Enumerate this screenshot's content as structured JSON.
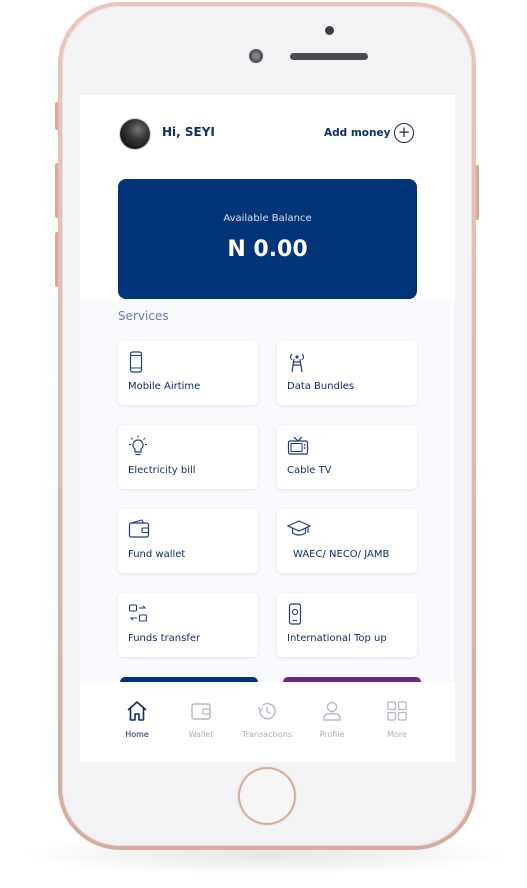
{
  "header": {
    "greeting": "Hi, SEYI",
    "add_money_label": "Add money"
  },
  "balance": {
    "label": "Available Balance",
    "amount": "N 0.00"
  },
  "services": {
    "title": "Services",
    "items": [
      {
        "label": "Mobile Airtime",
        "icon": "mobile-phone-icon"
      },
      {
        "label": "Data Bundles",
        "icon": "data-tower-icon"
      },
      {
        "label": "Electricity bill",
        "icon": "lightbulb-icon"
      },
      {
        "label": "Cable TV",
        "icon": "tv-icon"
      },
      {
        "label": "Fund wallet",
        "icon": "wallet-icon"
      },
      {
        "label": "WAEC/ NECO/ JAMB",
        "icon": "graduation-cap-icon"
      },
      {
        "label": "Funds transfer",
        "icon": "transfer-icon"
      },
      {
        "label": "International Top up",
        "icon": "phone-topup-icon"
      }
    ]
  },
  "nav": {
    "items": [
      {
        "label": "Home",
        "icon": "home-icon",
        "active": true
      },
      {
        "label": "Wallet",
        "icon": "wallet-icon"
      },
      {
        "label": "Transactions",
        "icon": "history-icon"
      },
      {
        "label": "Profile",
        "icon": "user-icon"
      },
      {
        "label": "More",
        "icon": "grid-icon"
      }
    ]
  },
  "colors": {
    "primary": "#003479",
    "accent_purple": "#6b2a78",
    "text_dark": "#0b2f6b",
    "muted": "#a9b0bd"
  }
}
